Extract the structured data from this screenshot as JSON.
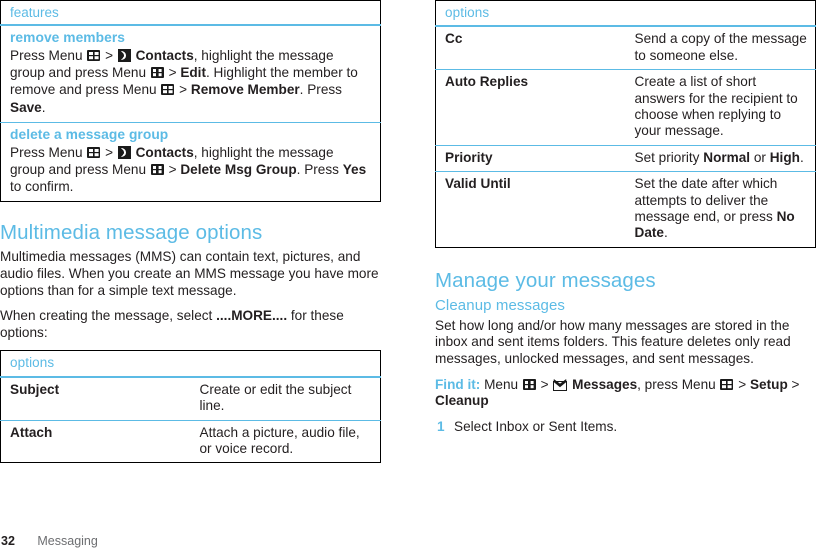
{
  "colors": {
    "accent_blue": "#5cbbe5",
    "text": "#231f20",
    "footer_text": "#6d6e71",
    "table_border": "#000000"
  },
  "footer": {
    "page_number": "32",
    "section_name": "Messaging"
  },
  "left_column": {
    "features_table": {
      "header": "features",
      "rows": [
        {
          "title": "remove members",
          "body_parts": [
            {
              "type": "text",
              "text": "Press Menu "
            },
            {
              "type": "icon",
              "icon": "menu-icon"
            },
            {
              "type": "text",
              "text": " > "
            },
            {
              "type": "icon",
              "icon": "contacts-icon"
            },
            {
              "type": "bold",
              "text": " Contacts"
            },
            {
              "type": "text",
              "text": ", highlight the message group and press Menu "
            },
            {
              "type": "icon",
              "icon": "menu-icon"
            },
            {
              "type": "text",
              "text": " > "
            },
            {
              "type": "bold",
              "text": "Edit"
            },
            {
              "type": "text",
              "text": ". Highlight the member to remove and press Menu "
            },
            {
              "type": "icon",
              "icon": "menu-icon"
            },
            {
              "type": "text",
              "text": " > "
            },
            {
              "type": "bold",
              "text": "Remove Member"
            },
            {
              "type": "text",
              "text": ". Press "
            },
            {
              "type": "bold",
              "text": "Save"
            },
            {
              "type": "text",
              "text": "."
            }
          ]
        },
        {
          "title": "delete a message group",
          "body_parts": [
            {
              "type": "text",
              "text": "Press Menu "
            },
            {
              "type": "icon",
              "icon": "menu-icon"
            },
            {
              "type": "text",
              "text": " > "
            },
            {
              "type": "icon",
              "icon": "contacts-icon"
            },
            {
              "type": "bold",
              "text": " Contacts"
            },
            {
              "type": "text",
              "text": ", highlight the message group and press Menu "
            },
            {
              "type": "icon",
              "icon": "menu-icon"
            },
            {
              "type": "text",
              "text": " > "
            },
            {
              "type": "bold",
              "text": "Delete Msg Group"
            },
            {
              "type": "text",
              "text": ". Press "
            },
            {
              "type": "bold",
              "text": "Yes"
            },
            {
              "type": "text",
              "text": " to confirm."
            }
          ]
        }
      ]
    },
    "section": {
      "heading": "Multimedia message options",
      "paragraph1": "Multimedia messages (MMS) can contain text, pictures, and audio files. When you create an MMS message you have more options than for a simple text message.",
      "paragraph2_parts": [
        {
          "type": "text",
          "text": "When creating the message, select "
        },
        {
          "type": "bold",
          "text": "....MORE...."
        },
        {
          "type": "text",
          "text": " for these options:"
        }
      ]
    },
    "options_table": {
      "header": "options",
      "rows": [
        {
          "term": "Subject",
          "desc": "Create or edit the subject line."
        },
        {
          "term": "Attach",
          "desc": "Attach a picture, audio file, or voice record."
        }
      ]
    }
  },
  "right_column": {
    "options_table": {
      "header": "options",
      "rows": [
        {
          "term": "Cc",
          "desc_parts": [
            {
              "type": "text",
              "text": "Send a copy of the message to someone else."
            }
          ]
        },
        {
          "term": "Auto Replies",
          "desc_parts": [
            {
              "type": "text",
              "text": "Create a list of short answers for the recipient to choose when replying to your message."
            }
          ]
        },
        {
          "term": "Priority",
          "desc_parts": [
            {
              "type": "text",
              "text": "Set priority "
            },
            {
              "type": "bold",
              "text": "Normal"
            },
            {
              "type": "text",
              "text": " or "
            },
            {
              "type": "bold",
              "text": "High"
            },
            {
              "type": "text",
              "text": "."
            }
          ]
        },
        {
          "term": "Valid Until",
          "desc_parts": [
            {
              "type": "text",
              "text": "Set the date after which attempts to deliver the message end, or press "
            },
            {
              "type": "bold",
              "text": "No Date"
            },
            {
              "type": "text",
              "text": "."
            }
          ]
        }
      ]
    },
    "section": {
      "heading": "Manage your messages",
      "subheading": "Cleanup messages",
      "paragraph1": "Set how long and/or how many messages are stored in the inbox and sent items folders. This feature deletes only read messages, unlocked messages, and sent messages.",
      "find_it_parts": [
        {
          "type": "findit",
          "text": "Find it:"
        },
        {
          "type": "text",
          "text": " Menu "
        },
        {
          "type": "icon",
          "icon": "menu-icon"
        },
        {
          "type": "text",
          "text": " > "
        },
        {
          "type": "icon",
          "icon": "messages-icon"
        },
        {
          "type": "bold",
          "text": " Messages"
        },
        {
          "type": "text",
          "text": ", press Menu "
        },
        {
          "type": "icon",
          "icon": "menu-icon"
        },
        {
          "type": "text",
          "text": " > "
        },
        {
          "type": "bold",
          "text": "Setup"
        },
        {
          "type": "text",
          "text": " > "
        },
        {
          "type": "bold",
          "text": "Cleanup"
        }
      ],
      "steps": [
        {
          "num": "1",
          "text": "Select Inbox or Sent Items."
        }
      ]
    }
  }
}
